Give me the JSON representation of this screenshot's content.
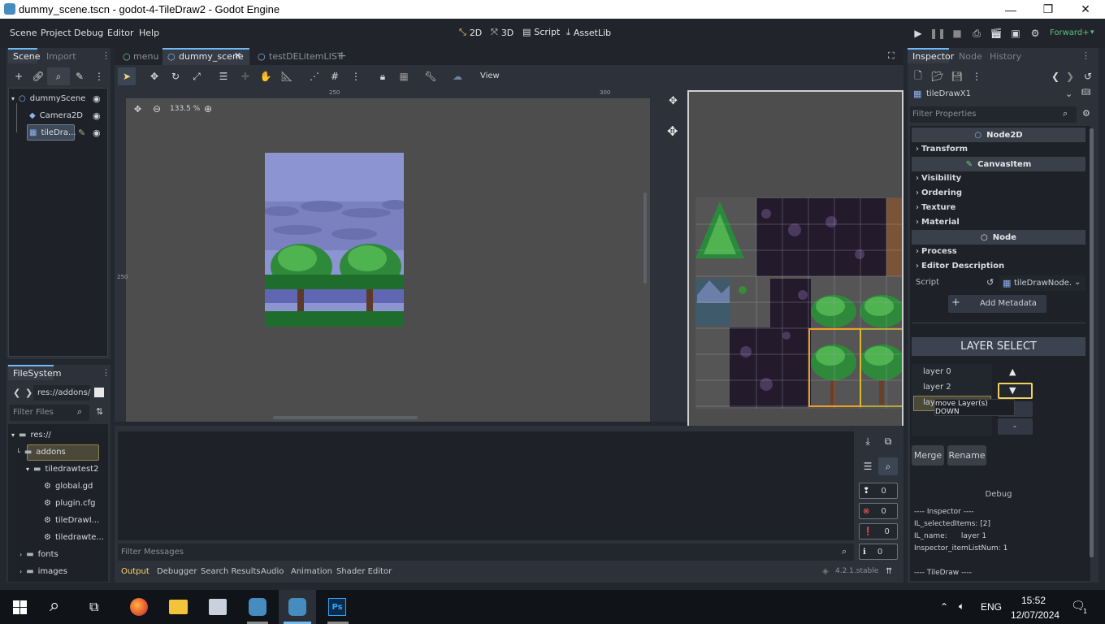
{
  "window": {
    "title": "dummy_scene.tscn - godot-4-TileDraw2 - Godot Engine",
    "buttons": [
      "—",
      "❐",
      "✕"
    ]
  },
  "menu": {
    "items": [
      "Scene",
      "Project",
      "Debug",
      "Editor",
      "Help"
    ],
    "workspaces": [
      {
        "label": "2D",
        "icon": "2d-icon"
      },
      {
        "label": "3D",
        "icon": "3d-icon"
      },
      {
        "label": "Script",
        "icon": "script-icon"
      },
      {
        "label": "AssetLib",
        "icon": "assetlib-icon"
      }
    ],
    "renderer": "Forward+"
  },
  "scene_dock": {
    "tabs": [
      "Scene",
      "Import"
    ],
    "nodes": [
      {
        "label": "dummyScene",
        "icon": "node2d-icon"
      },
      {
        "label": "Camera2D",
        "icon": "camera2d-icon"
      },
      {
        "label": "tileDra...",
        "icon": "tiledraw-icon"
      }
    ]
  },
  "filesystem": {
    "title": "FileSystem",
    "path": "res://addons/",
    "filter_placeholder": "Filter Files",
    "items": [
      {
        "label": "res://",
        "type": "folder"
      },
      {
        "label": "addons",
        "type": "folder"
      },
      {
        "label": "tiledrawtest2",
        "type": "folder"
      },
      {
        "label": "global.gd",
        "type": "script"
      },
      {
        "label": "plugin.cfg",
        "type": "config"
      },
      {
        "label": "tileDrawI...",
        "type": "script"
      },
      {
        "label": "tiledrawte...",
        "type": "script"
      },
      {
        "label": "fonts",
        "type": "folder"
      },
      {
        "label": "images",
        "type": "folder"
      }
    ]
  },
  "scene_tabs": [
    "menu",
    "dummy_scene",
    "testDELitemLIST"
  ],
  "viewport": {
    "zoom": "133.5 %",
    "view_menu": "View",
    "ruler_labels": [
      "250",
      "300",
      "250"
    ]
  },
  "output": {
    "filter_placeholder": "Filter Messages",
    "counts": [
      "0",
      "0",
      "0",
      "0"
    ],
    "tabs": [
      "Output",
      "Debugger",
      "Search Results",
      "Audio",
      "Animation",
      "Shader Editor"
    ],
    "version": "4.2.1.stable"
  },
  "inspector": {
    "tabs": [
      "Inspector",
      "Node",
      "History"
    ],
    "object": "tileDrawX1",
    "filter_placeholder": "Filter Properties",
    "sections": [
      {
        "kind": "header",
        "label": "Node2D"
      },
      {
        "kind": "group",
        "label": "Transform"
      },
      {
        "kind": "header",
        "label": "CanvasItem"
      },
      {
        "kind": "group",
        "label": "Visibility"
      },
      {
        "kind": "group",
        "label": "Ordering"
      },
      {
        "kind": "group",
        "label": "Texture"
      },
      {
        "kind": "group",
        "label": "Material"
      },
      {
        "kind": "header",
        "label": "Node"
      },
      {
        "kind": "group",
        "label": "Process"
      },
      {
        "kind": "group",
        "label": "Editor Description"
      }
    ],
    "script_label": "Script",
    "script_value": "tileDrawNode.",
    "add_metadata": "Add Metadata",
    "layer_select": {
      "title": "LAYER SELECT",
      "layers": [
        "layer 0",
        "layer 2",
        "layer 1"
      ],
      "selected_label": "laye",
      "minus_label": "-",
      "tooltip": "move Layer(s) DOWN"
    },
    "merge": "Merge",
    "rename": "Rename",
    "debug": {
      "title": "Debug",
      "lines": [
        "---- Inspector ----",
        "IL_selectedItems: [2]",
        "IL_name:      layer 1",
        "Inspector_itemListNum: 1",
        "",
        "---- TileDraw ----"
      ]
    }
  },
  "taskbar": {
    "language": "ENG",
    "time": "15:52",
    "date": "12/07/2024",
    "notification_count": "1"
  },
  "colors": {
    "accent": "#478cbf",
    "selection": "#f0c040",
    "panel": "#2d323a",
    "viewport_bg": "#4d4d4d",
    "sky": "#8c94d2"
  }
}
